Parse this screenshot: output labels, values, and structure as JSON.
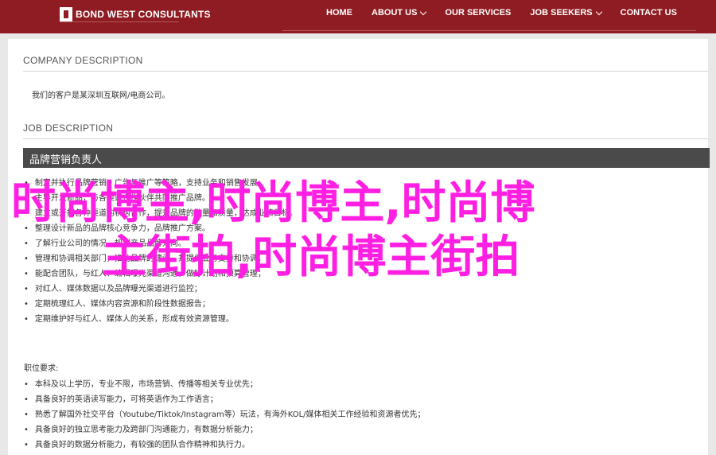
{
  "header": {
    "logo": "BOND WEST CONSULTANTS",
    "nav": [
      {
        "label": "HOME"
      },
      {
        "label": "ABOUT US"
      },
      {
        "label": "OUR SERVICES"
      },
      {
        "label": "JOB SEEKERS"
      },
      {
        "label": "CONTACT US"
      }
    ]
  },
  "company": {
    "title": "COMPANY DESCRIPTION",
    "text": "我们的客户是某深圳互联网/电商公司。"
  },
  "job": {
    "title": "JOB DESCRIPTION",
    "position": "品牌营销负责人",
    "duties": [
      "制定并执行品牌营销、广告与推广等策略，支持业务和销售发展。",
      "主导开发新品，与各渠道合作伙伴共同推广品牌。",
      "建立或开拓各种渠道的机构合作，提升品牌的数量和质量，达成业绩目标。",
      "整理设计新品的品牌核心竞争力，品牌推广方案。",
      "了解行业公司的情况，规划产品品牌方向。",
      "管理和协调相关部门，推动品牌的建设，并提供业务支持和协调。",
      "能配合团队，与红人、编辑曝光渠道沟通，做好计划和预算管理；",
      "对红人、媒体数据以及品牌曝光渠道进行监控；",
      "定期梳理红人、媒体内容资源和阶段性数据报告；",
      "定期维护好与红人、媒体人的关系，形成有效资源管理。"
    ],
    "requirements_title": "职位要求:",
    "requirements": [
      "本科及以上学历，专业不限，市场营销、传播等相关专业优先；",
      "具备良好的英语读写能力，可将英语作为工作语言；",
      "熟悉了解国外社交平台（Youtube/Tiktok/Instagram等）玩法，有海外KOL/媒体相关工作经验和资源者优先；",
      "具备良好的独立思考能力及跨部门沟通能力，有数据分析能力；",
      "具备良好的数据分析能力，有较强的团队合作精神和执行力。"
    ]
  },
  "overlay": {
    "line1": "时尚博主,时尚博主,时尚博",
    "line2": "主街拍,时尚博主街拍"
  }
}
